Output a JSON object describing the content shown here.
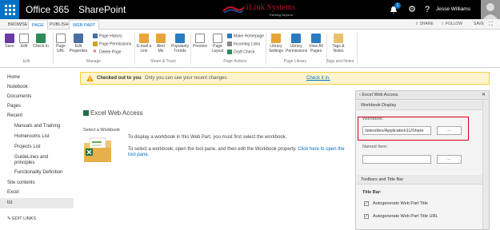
{
  "suite": {
    "app_name": "Office 365",
    "site_name": "SharePoint",
    "logo_text": "iLink Systems",
    "logo_tagline": "Thinking Beyond",
    "notification_count": "1",
    "user_name": "Jesse Williams"
  },
  "tabs": {
    "browse": "BROWSE",
    "page": "PAGE",
    "publish": "PUBLISH",
    "web_part": "WEB PART",
    "share": "SHARE",
    "follow": "FOLLOW",
    "save": "SAVE"
  },
  "ribbon": {
    "save": "Save",
    "edit": "Edit",
    "check_in": "Check In",
    "edit_group": "Edit",
    "page_url": "Page URL",
    "edit_properties": "Edit Properties",
    "page_history": "Page History",
    "page_permissions": "Page Permissions",
    "delete_page": "Delete Page",
    "manage_group": "Manage",
    "email_link": "E-mail a Link",
    "alert_me": "Alert Me",
    "popularity_trends": "Popularity Trends",
    "share_group": "Share & Track",
    "preview": "Preview",
    "page_layout": "Page Layout",
    "make_homepage": "Make Homepage",
    "incoming_links": "Incoming Links",
    "draft_check": "Draft Check",
    "page_actions_group": "Page Actions",
    "library_settings": "Library Settings",
    "library_permissions": "Library Permissions",
    "view_all_pages": "View All Pages",
    "page_library_group": "Page Library",
    "tags_notes": "Tags & Notes",
    "tags_group": "Tags and Notes"
  },
  "nav": {
    "home": "Home",
    "notebook": "Notebook",
    "documents": "Documents",
    "pages": "Pages",
    "recent": "Recent",
    "recent_items": [
      "Manuals and Training",
      "Homerooms List",
      "Projects List",
      "GuideLines and principles",
      "Functionality Definition"
    ],
    "site_contents": "Site contents",
    "excel": "Excel",
    "tst": "tst",
    "edit_links": "EDIT LINKS"
  },
  "status": {
    "title": "Checked out to you",
    "message": "Only you can see your recent changes.",
    "link": "Check it in."
  },
  "webpart": {
    "title": "Excel Web Access",
    "select_label": "Select a Workbook",
    "line1": "To display a workbook in this Web Part, you must first select the workbook.",
    "line2a": "To select a workbook, open the tool pane, and then edit the Workbook property.",
    "line2_link": "Click here to open the tool pane."
  },
  "toolpane": {
    "title": "Excel Web Access",
    "section_display": "Workbook Display",
    "workbook_label": "Workbook:",
    "workbook_value": "/sites/dev/Application11/Share",
    "browse_btn": "...",
    "named_item_label": "Named Item:",
    "named_item_value": "",
    "section_toolbars": "Toolbars and Title Bar",
    "title_bar_label": "Title Bar:",
    "opt1": "Autogenerate Web Part Title",
    "opt2": "Autogenerate Web Part Title URL",
    "opt1_checked": true,
    "opt2_checked": true
  }
}
